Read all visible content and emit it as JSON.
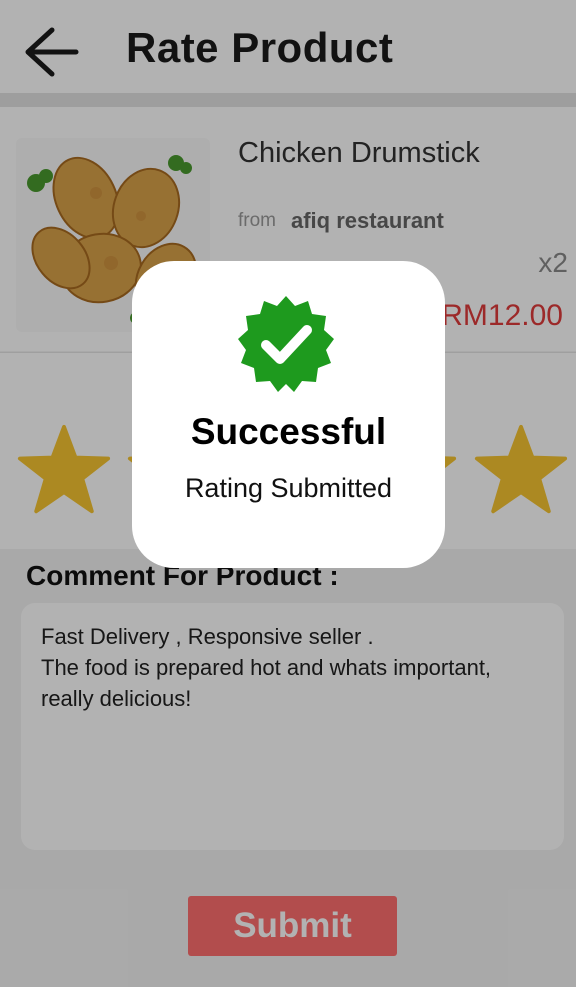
{
  "header": {
    "title": "Rate Product"
  },
  "product": {
    "name": "Chicken Drumstick",
    "from_label": "from",
    "restaurant": "afiq restaurant",
    "quantity": "x2",
    "price": "RM12.00"
  },
  "rating": {
    "value": 5,
    "max": 5,
    "star_color": "#f7c531"
  },
  "comment": {
    "label": "Comment For Product :",
    "text": "Fast Delivery , Responsive seller .\nThe food is prepared hot and whats important, really delicious!"
  },
  "submit": {
    "label": "Submit",
    "color": "#ff6f6f"
  },
  "modal": {
    "title": "Successful",
    "subtitle": "Rating Submitted",
    "badge_color": "#1e9a1e"
  }
}
